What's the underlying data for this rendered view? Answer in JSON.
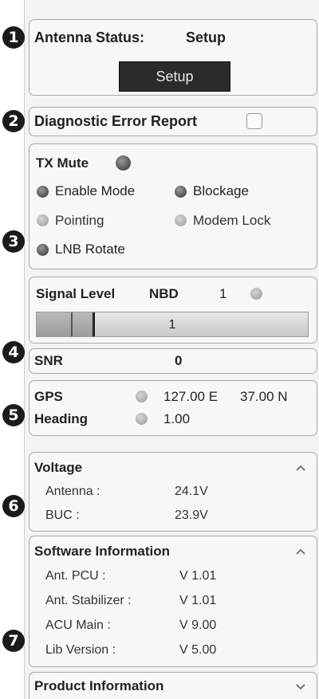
{
  "markers": [
    "1",
    "2",
    "3",
    "4",
    "5",
    "6",
    "7"
  ],
  "antenna_status": {
    "label": "Antenna Status:",
    "value": "Setup",
    "button_label": "Setup"
  },
  "diagnostic": {
    "label": "Diagnostic Error Report",
    "checked": false
  },
  "status_leds": {
    "tx_mute": {
      "label": "TX Mute",
      "state": "dark"
    },
    "enable_mode": {
      "label": "Enable Mode",
      "state": "dark"
    },
    "blockage": {
      "label": "Blockage",
      "state": "dark"
    },
    "pointing": {
      "label": "Pointing",
      "state": "light"
    },
    "modem_lock": {
      "label": "Modem Lock",
      "state": "light"
    },
    "lnb_rotate": {
      "label": "LNB Rotate",
      "state": "dark"
    }
  },
  "signal": {
    "label": "Signal Level",
    "mode": "NBD",
    "value": "1",
    "bar_value": "1",
    "led_state": "light"
  },
  "snr": {
    "label": "SNR",
    "value": "0"
  },
  "gps": {
    "label": "GPS",
    "lon": "127.00 E",
    "lat": "37.00 N",
    "led_state": "light"
  },
  "heading": {
    "label": "Heading",
    "value": "1.00",
    "led_state": "light"
  },
  "voltage": {
    "title": "Voltage",
    "rows": [
      {
        "label": "Antenna :",
        "value": "24.1V"
      },
      {
        "label": "BUC :",
        "value": "23.9V"
      }
    ]
  },
  "software": {
    "title": "Software Information",
    "rows": [
      {
        "label": "Ant. PCU :",
        "value": "V 1.01"
      },
      {
        "label": "Ant. Stabilizer :",
        "value": "V 1.01"
      },
      {
        "label": "ACU Main :",
        "value": "V 9.00"
      },
      {
        "label": "Lib Version :",
        "value": "V 5.00"
      }
    ]
  },
  "product": {
    "title": "Product Information"
  }
}
